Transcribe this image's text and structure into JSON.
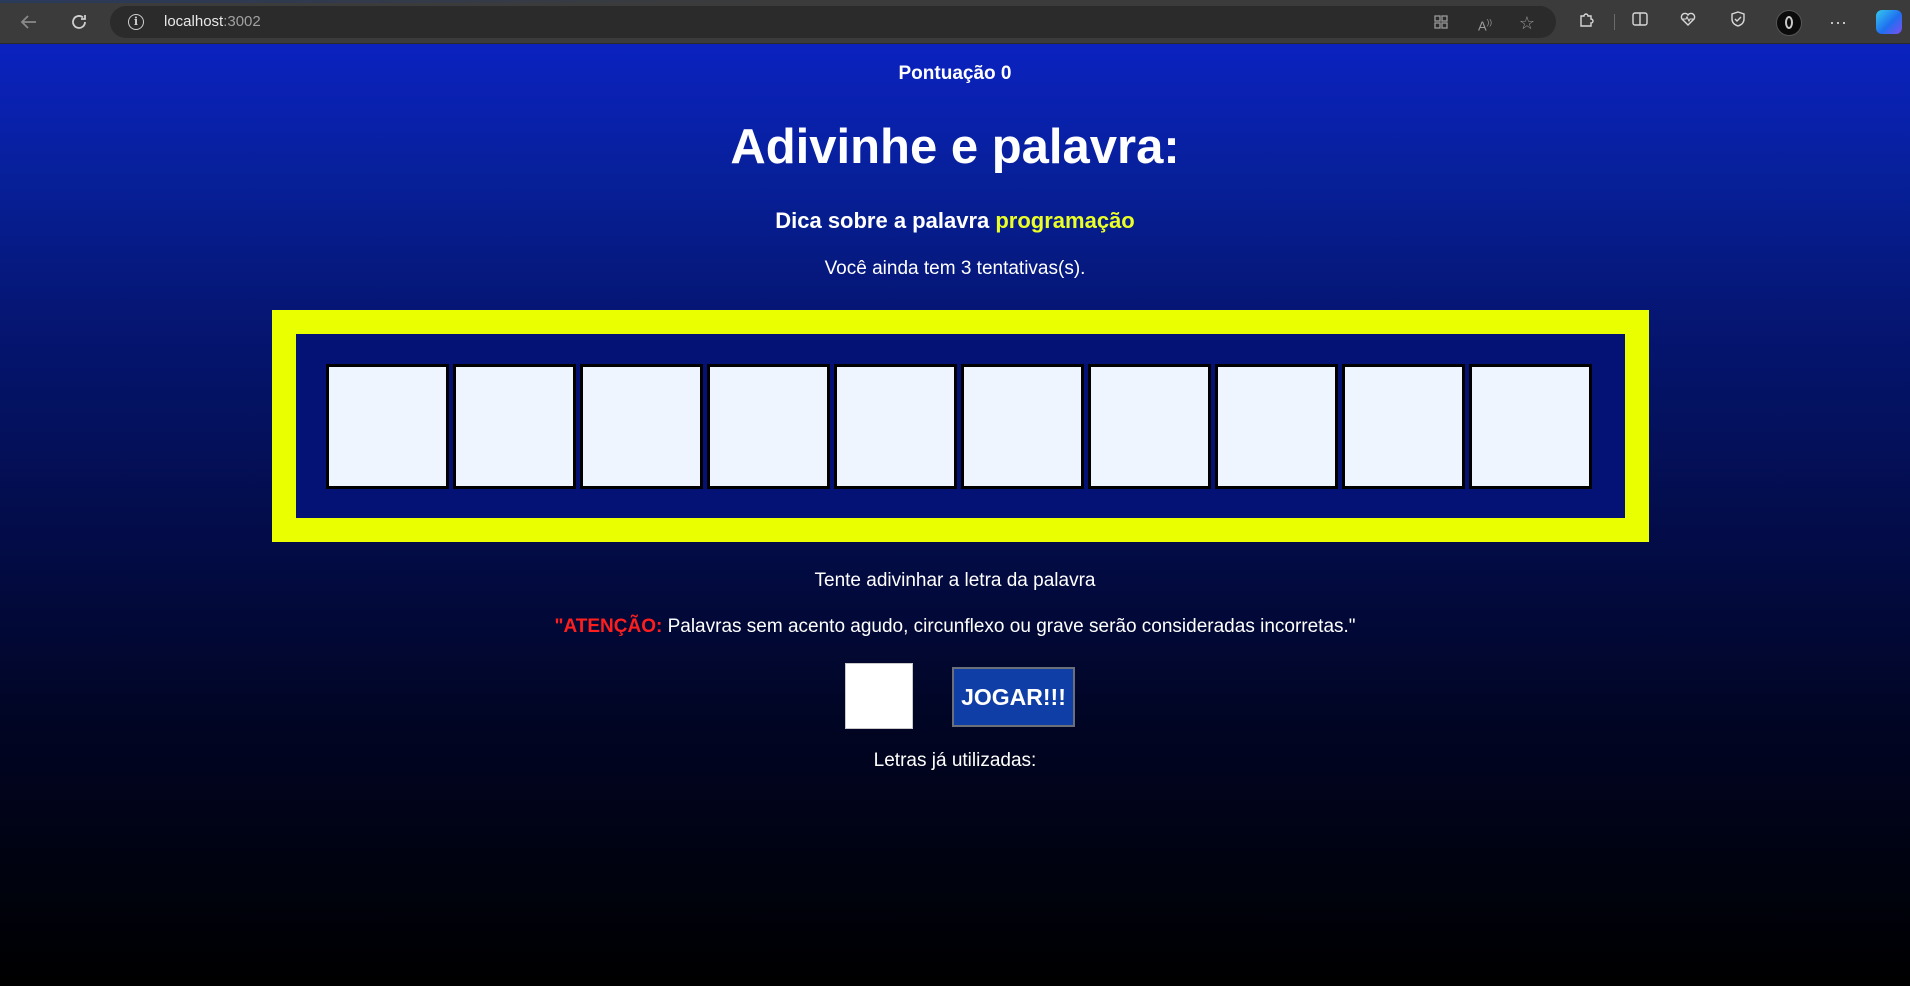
{
  "browser": {
    "url_host": "localhost",
    "url_port": ":3002",
    "icons": {
      "back": "arrow-left-icon",
      "reload": "reload-icon",
      "site_info": "info-icon",
      "app_grid": "app-grid-icon",
      "read_aloud": "read-aloud-icon",
      "favorite": "star-icon",
      "extensions": "puzzle-icon",
      "split_screen": "split-screen-icon",
      "browser_essentials": "heart-pulse-icon",
      "security": "shield-icon",
      "profile": "avatar",
      "more": "more-dots-icon",
      "copilot": "copilot-icon"
    }
  },
  "game": {
    "score_label": "Pontuação 0",
    "title": "Adivinhe e palavra:",
    "hint_prefix": "Dica sobre a palavra ",
    "hint_word": "programação",
    "tries_text": "Você ainda tem 3 tentativas(s).",
    "letters": [
      "",
      "",
      "",
      "",
      "",
      "",
      "",
      "",
      "",
      ""
    ],
    "try_text": "Tente adivinhar a letra da palavra",
    "warning_label": "\"ATENÇÃO:",
    "warning_text": " Palavras sem acento agudo, circunflexo ou grave serão consideradas incorretas.\"",
    "guess_value": "",
    "play_button": "JOGAR!!!",
    "used_letters_label": "Letras já utilizadas:"
  },
  "colors": {
    "board_border": "#eaff00",
    "board_background": "#041276",
    "letter_box": "#eef5fe",
    "hint_word": "#eaff26",
    "warning": "#ff1e1e",
    "button": "#0f3fa6"
  }
}
